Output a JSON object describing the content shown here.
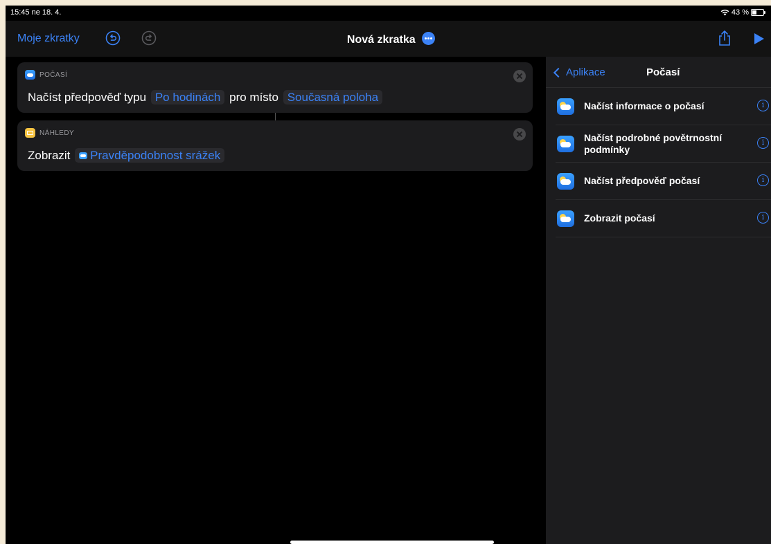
{
  "status_bar": {
    "time_date": "15:45  ne 18. 4.",
    "battery": "43 %"
  },
  "nav": {
    "back_label": "Moje zkratky",
    "title": "Nová zkratka"
  },
  "editor": {
    "cards": [
      {
        "app_label": "POČASÍ",
        "text_1": "Načíst předpověď typu",
        "token_1": "Po hodinách",
        "text_2": "pro místo",
        "token_2": "Současná poloha"
      },
      {
        "app_label": "NÁHLEDY",
        "text_1": "Zobrazit",
        "token_1": "Pravděpodobnost srážek"
      }
    ]
  },
  "sidebar": {
    "back_label": "Aplikace",
    "title": "Počasí",
    "items": [
      {
        "label": "Načíst informace o počasí"
      },
      {
        "label": "Načíst podrobné povětrnostní podmínky"
      },
      {
        "label": "Načíst předpověď počasí"
      },
      {
        "label": "Zobrazit počasí"
      }
    ]
  },
  "colors": {
    "accent": "#3b82f6",
    "background": "#000000",
    "card": "#1c1c1e",
    "frame": "#f5ebd7"
  },
  "icons": [
    "wifi-icon",
    "battery-icon",
    "undo-icon",
    "redo-icon",
    "more-icon",
    "share-icon",
    "play-icon",
    "weather-icon",
    "notes-icon",
    "close-icon",
    "chevron-left-icon",
    "info-icon"
  ]
}
